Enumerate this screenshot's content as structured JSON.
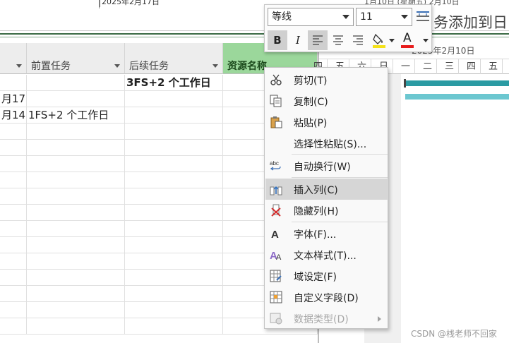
{
  "timeline": {
    "date_left": "2025年2月17日",
    "date_right": "1月10日 (星期五) 2月10日"
  },
  "title_fragment": "务添加到日",
  "columns": [
    {
      "label": ""
    },
    {
      "label": "前置任务"
    },
    {
      "label": "后续任务"
    },
    {
      "label": "资源名称"
    }
  ],
  "rows": [
    {
      "start": "",
      "pred": "",
      "succ": "3FS+2 个工作日",
      "res": ""
    },
    {
      "start": "月17",
      "pred": "",
      "succ": "",
      "res": ""
    },
    {
      "start": "月14",
      "pred": "1FS+2 个工作日",
      "succ": "",
      "res": ""
    },
    {
      "start": "",
      "pred": "",
      "succ": "",
      "res": ""
    },
    {
      "start": "",
      "pred": "",
      "succ": "",
      "res": ""
    },
    {
      "start": "",
      "pred": "",
      "succ": "",
      "res": ""
    },
    {
      "start": "",
      "pred": "",
      "succ": "",
      "res": ""
    },
    {
      "start": "",
      "pred": "",
      "succ": "",
      "res": ""
    },
    {
      "start": "",
      "pred": "",
      "succ": "",
      "res": ""
    },
    {
      "start": "",
      "pred": "",
      "succ": "",
      "res": ""
    },
    {
      "start": "",
      "pred": "",
      "succ": "",
      "res": ""
    },
    {
      "start": "",
      "pred": "",
      "succ": "",
      "res": ""
    },
    {
      "start": "",
      "pred": "",
      "succ": "",
      "res": ""
    },
    {
      "start": "",
      "pred": "",
      "succ": "",
      "res": ""
    },
    {
      "start": "",
      "pred": "",
      "succ": "",
      "res": ""
    },
    {
      "start": "",
      "pred": "",
      "succ": "",
      "res": ""
    }
  ],
  "gantt": {
    "week_label": "2025年2月10日",
    "days": [
      "四",
      "五",
      "六",
      "日",
      "一",
      "二",
      "三",
      "四",
      "五"
    ]
  },
  "toolbar": {
    "font_name": "等线",
    "font_size": "11",
    "bold_label": "B",
    "italic_label": "I",
    "font_color_label": "A",
    "fill_color": "#f5e21a",
    "font_color": "#e81c1c"
  },
  "context_menu": {
    "items": [
      {
        "label": "剪切(T)",
        "icon": "scissors-icon"
      },
      {
        "label": "复制(C)",
        "icon": "copy-icon"
      },
      {
        "label": "粘贴(P)",
        "icon": "paste-icon"
      },
      {
        "label": "选择性粘贴(S)...",
        "icon": ""
      },
      {
        "label": "自动换行(W)",
        "icon": "wrap-text-icon"
      },
      {
        "label": "插入列(C)",
        "icon": "insert-column-icon",
        "highlighted": true
      },
      {
        "label": "隐藏列(H)",
        "icon": "hide-column-icon"
      },
      {
        "label": "字体(F)...",
        "icon": "font-icon"
      },
      {
        "label": "文本样式(T)...",
        "icon": "text-style-icon"
      },
      {
        "label": "域设定(F)",
        "icon": "field-settings-icon"
      },
      {
        "label": "自定义字段(D)",
        "icon": "custom-field-icon"
      },
      {
        "label": "数据类型(D)",
        "icon": "data-type-icon",
        "disabled": true
      }
    ]
  },
  "watermark": "CSDN @桟老师不回家"
}
